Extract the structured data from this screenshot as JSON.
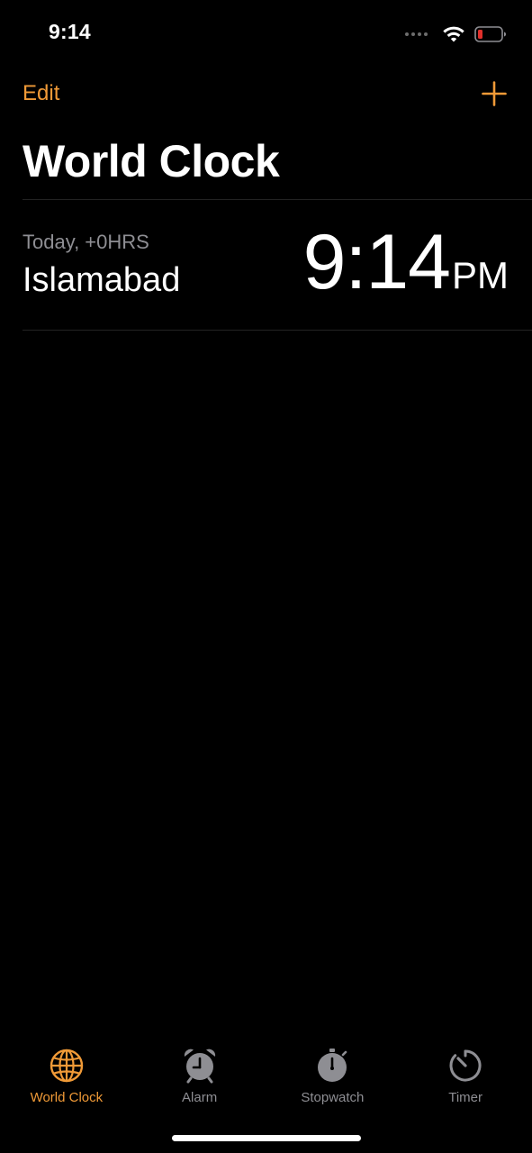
{
  "status_bar": {
    "time": "9:14",
    "icons": [
      "cellular-signal-icon",
      "wifi-icon",
      "battery-icon"
    ],
    "battery_color": "#e0302b"
  },
  "nav": {
    "edit_label": "Edit",
    "add_icon": "plus-icon"
  },
  "title": "World Clock",
  "clocks": [
    {
      "offset": "Today, +0HRS",
      "city": "Islamabad",
      "time": "9:14",
      "ampm": "PM"
    }
  ],
  "tabs": [
    {
      "label": "World Clock",
      "icon": "globe-icon",
      "active": true
    },
    {
      "label": "Alarm",
      "icon": "alarm-clock-icon",
      "active": false
    },
    {
      "label": "Stopwatch",
      "icon": "stopwatch-icon",
      "active": false
    },
    {
      "label": "Timer",
      "icon": "timer-icon",
      "active": false
    }
  ],
  "colors": {
    "accent": "#f09a37",
    "background": "#000000",
    "secondary_text": "#8e8e93",
    "inactive_icon": "#8e8e93"
  }
}
